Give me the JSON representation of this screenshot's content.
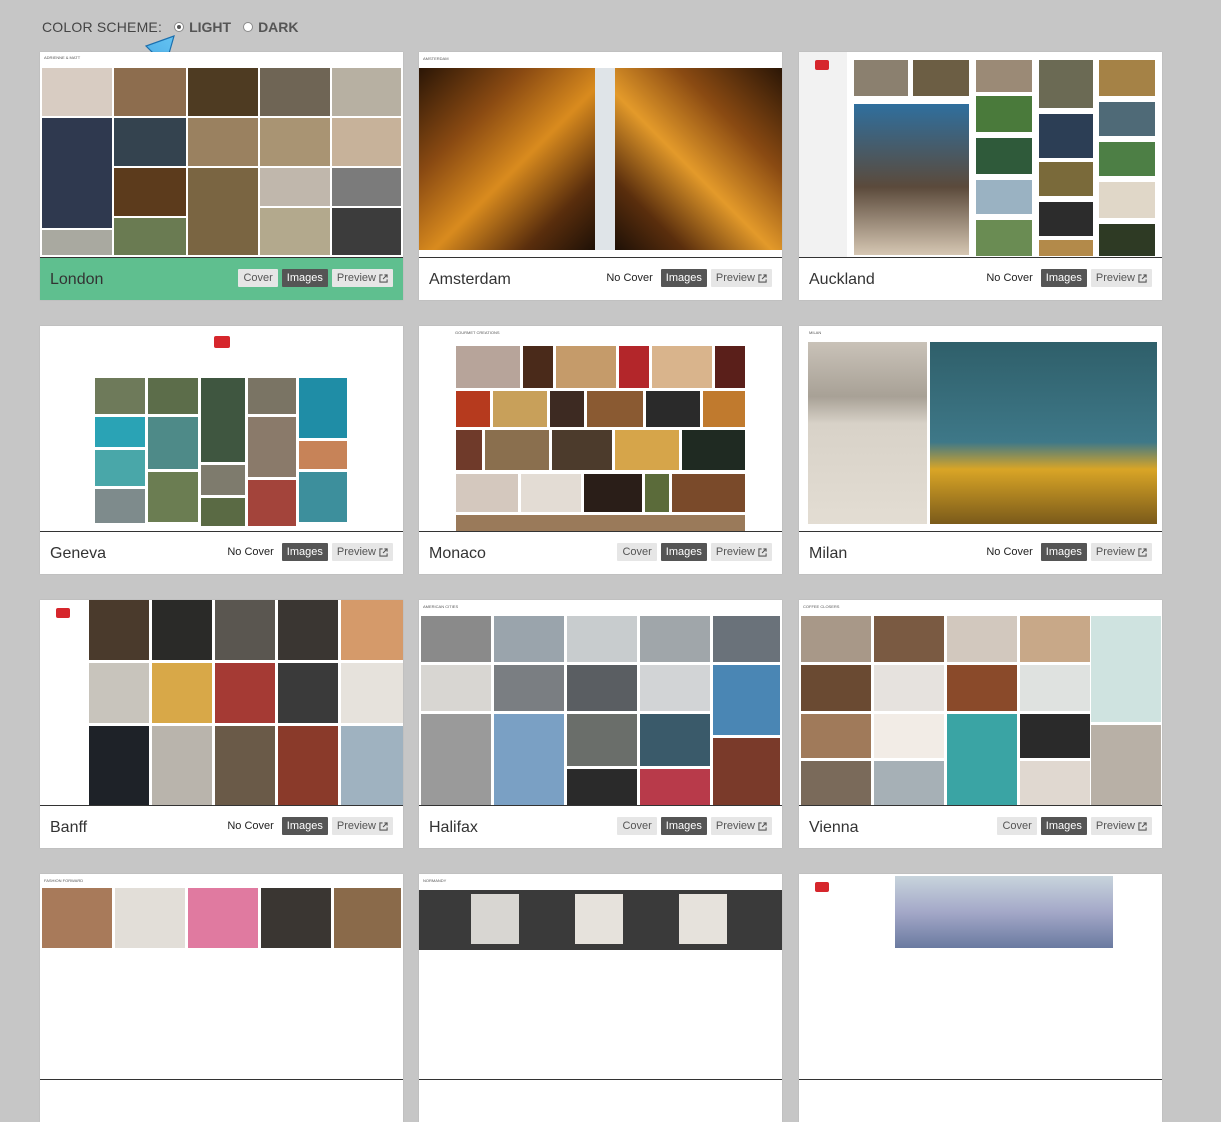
{
  "color_scheme": {
    "label": "COLOR SCHEME:",
    "options": [
      {
        "label": "LIGHT",
        "selected": true
      },
      {
        "label": "DARK",
        "selected": false
      }
    ]
  },
  "buttons": {
    "cover": "Cover",
    "no_cover": "No Cover",
    "images": "Images",
    "preview": "Preview"
  },
  "icons": {
    "preview": "external-link-icon",
    "pointer": "arrow-pointer-icon"
  },
  "colors": {
    "active": "#5fbf8f",
    "page_bg": "#c6c6c6",
    "images_btn": "#555555"
  },
  "themes": [
    {
      "name": "London",
      "cover": true,
      "active": true
    },
    {
      "name": "Amsterdam",
      "cover": false
    },
    {
      "name": "Auckland",
      "cover": false
    },
    {
      "name": "Geneva",
      "cover": false
    },
    {
      "name": "Monaco",
      "cover": true
    },
    {
      "name": "Milan",
      "cover": false
    },
    {
      "name": "Banff",
      "cover": false
    },
    {
      "name": "Halifax",
      "cover": true
    },
    {
      "name": "Vienna",
      "cover": true
    },
    {
      "name": "",
      "cover": false
    },
    {
      "name": "",
      "cover": false
    },
    {
      "name": "",
      "cover": false
    }
  ]
}
